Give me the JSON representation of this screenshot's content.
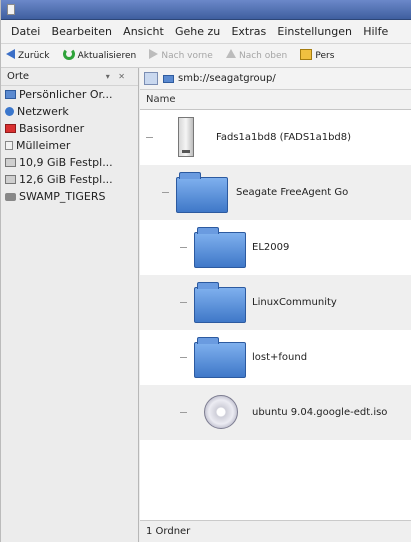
{
  "menubar": {
    "items": [
      "Datei",
      "Bearbeiten",
      "Ansicht",
      "Gehe zu",
      "Extras",
      "Einstellungen",
      "Hilfe"
    ]
  },
  "toolbar": {
    "back_label": "Zurück",
    "reload_label": "Aktualisieren",
    "forward_label": "Nach vorne",
    "up_label": "Nach oben",
    "home_label": "Pers"
  },
  "sidebar": {
    "header": "Orte",
    "items": [
      {
        "label": "Persönlicher Or...",
        "icon": "folder-blue-icon"
      },
      {
        "label": "Netzwerk",
        "icon": "network-icon"
      },
      {
        "label": "Basisordner",
        "icon": "home-folder-icon"
      },
      {
        "label": "Mülleimer",
        "icon": "trash-icon"
      },
      {
        "label": "10,9 GiB Festpl...",
        "icon": "drive-icon"
      },
      {
        "label": "12,6 GiB Festpl...",
        "icon": "drive-icon"
      },
      {
        "label": "SWAMP_TIGERS",
        "icon": "network-share-icon"
      }
    ]
  },
  "location": {
    "path": "smb://seagatgroup/"
  },
  "columns": {
    "name": "Name"
  },
  "tree": [
    {
      "label": "Fads1a1bd8 (FADS1a1bd8)",
      "icon": "drive-icon"
    },
    {
      "label": "Seagate FreeAgent Go",
      "icon": "folder-icon"
    },
    {
      "label": "EL2009",
      "icon": "folder-icon"
    },
    {
      "label": "LinuxCommunity",
      "icon": "folder-icon"
    },
    {
      "label": "lost+found",
      "icon": "folder-icon"
    },
    {
      "label": "ubuntu 9.04.google-edt.iso",
      "icon": "disc-image-icon"
    }
  ],
  "status": {
    "text": "1 Ordner"
  }
}
